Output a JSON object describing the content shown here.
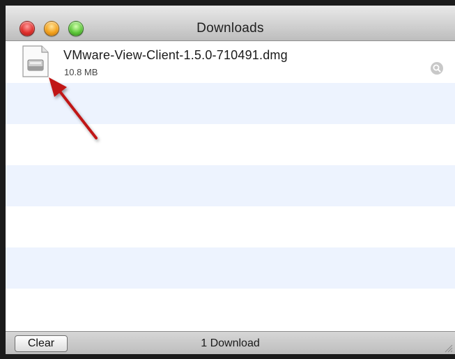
{
  "window": {
    "title": "Downloads",
    "buttons": [
      "close",
      "minimize",
      "zoom"
    ]
  },
  "downloads": [
    {
      "name": "VMware-View-Client-1.5.0-710491.dmg",
      "size": "10.8 MB",
      "icon": "disk-image-icon",
      "action_icon": "magnifier-icon"
    }
  ],
  "annotation": {
    "icon": "red-arrow-icon",
    "color": "#c01818",
    "points_to": "disk-image-icon"
  },
  "statusbar": {
    "clear_label": "Clear",
    "count_label": "1 Download"
  },
  "colors": {
    "stripe": "#edf3fe",
    "arrow": "#c01818"
  }
}
